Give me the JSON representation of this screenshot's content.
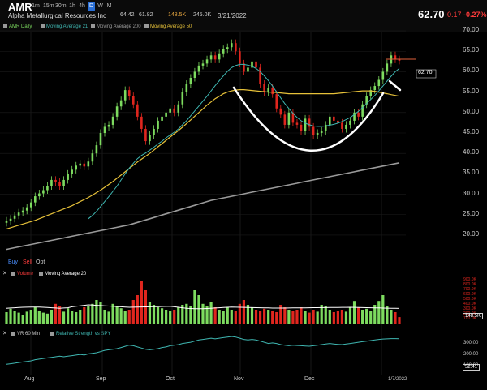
{
  "toolbar": {
    "symbol": "AMR",
    "intervals": [
      "1m",
      "15m",
      "30m",
      "1h",
      "4h",
      "D",
      "W",
      "M"
    ],
    "active_interval": "D",
    "date": "3/21/2022",
    "price": "62.70",
    "change": "-0.17",
    "change_pct": "-0.27%",
    "company": "Alpha Metallurgical Resources Inc",
    "high": "64.42",
    "low": "61.82",
    "volume": "148.5K",
    "avg_volume": "245.0K"
  },
  "legend": {
    "series": "AMR Daily",
    "ma21": "Moving Average 21",
    "ma200": "Moving Average 200",
    "ma50": "Moving Average 50"
  },
  "trade": {
    "buy": "Buy",
    "sell": "Sell",
    "opt": "Opt"
  },
  "volume_panel": {
    "label": "Volume",
    "ma": "Moving Average 20",
    "current": "148.5K"
  },
  "rs_panel": {
    "label": "VR 60 Min",
    "rs": "Relative Strength vs SPY",
    "current": "52.41"
  },
  "colors": {
    "up": "#7ddb5f",
    "down": "#e0261e",
    "ma21": "#3fb7b2",
    "ma50": "#e6c139",
    "ma200": "#9a9a9a",
    "accent": "#2a6fd6",
    "negative": "#ff3b3b",
    "bowl": "#ffffff"
  },
  "chart_data": {
    "type": "line",
    "title": "AMR Daily",
    "y_ticks": [
      "70.00",
      "65.00",
      "60.00",
      "55.00",
      "50.00",
      "45.00",
      "40.00",
      "35.00",
      "30.00",
      "25.00",
      "20.00"
    ],
    "x_ticks": [
      "Aug",
      "Sep",
      "Oct",
      "Nov",
      "Dec"
    ],
    "end_date_label": "1/7/2022",
    "vol_ticks": [
      "900.0K",
      "800.0K",
      "700.0K",
      "600.0K",
      "500.0K",
      "400.0K",
      "300.0K",
      "200.0K",
      "100.0K"
    ],
    "rs_ticks": [
      "300.00",
      "200.00",
      "100.00"
    ],
    "ylim": [
      18,
      72
    ],
    "close": [
      23.5,
      24.0,
      24.8,
      25.5,
      26.0,
      26.8,
      28.0,
      29.5,
      30.2,
      31.0,
      32.0,
      33.5,
      33.0,
      32.0,
      33.5,
      35.0,
      36.0,
      37.0,
      37.5,
      36.8,
      38.0,
      40.0,
      42.0,
      45.0,
      46.5,
      47.0,
      49.0,
      51.5,
      53.0,
      55.5,
      54.0,
      52.0,
      49.0,
      46.0,
      43.0,
      44.5,
      46.0,
      48.0,
      49.0,
      50.0,
      51.0,
      50.0,
      52.0,
      55.0,
      57.0,
      58.5,
      60.0,
      61.5,
      62.0,
      63.0,
      64.0,
      63.0,
      64.5,
      65.5,
      66.0,
      67.0,
      65.0,
      62.0,
      60.0,
      61.0,
      62.5,
      61.0,
      57.0,
      55.0,
      56.0,
      54.5,
      51.0,
      49.5,
      47.0,
      50.0,
      47.5,
      47.0,
      45.5,
      48.5,
      46.5,
      44.5,
      45.0,
      45.5,
      47.0,
      49.0,
      48.0,
      47.5,
      46.0,
      47.0,
      48.0,
      50.0,
      49.0,
      52.0,
      54.0,
      55.5,
      56.5,
      58.0,
      60.0,
      62.0,
      64.0,
      63.0,
      62.7
    ],
    "ma21": [
      null,
      null,
      null,
      null,
      null,
      null,
      null,
      null,
      null,
      null,
      null,
      null,
      null,
      null,
      null,
      null,
      null,
      null,
      null,
      null,
      24.0,
      24.8,
      25.8,
      27.0,
      28.2,
      29.4,
      30.7,
      32.0,
      33.5,
      35.0,
      36.4,
      37.6,
      38.7,
      39.5,
      40.1,
      40.8,
      41.5,
      42.3,
      43.0,
      43.8,
      44.5,
      45.2,
      46.0,
      47.0,
      48.0,
      49.2,
      50.4,
      51.6,
      52.8,
      54.0,
      55.3,
      56.6,
      57.8,
      59.0,
      60.1,
      61.0,
      61.5,
      61.8,
      61.8,
      61.6,
      61.3,
      60.8,
      60.0,
      59.0,
      57.8,
      56.5,
      55.0,
      53.6,
      52.2,
      51.0,
      49.8,
      48.8,
      48.0,
      47.4,
      47.0,
      46.7,
      46.6,
      46.6,
      46.7,
      46.9,
      47.1,
      47.4,
      47.8,
      48.3,
      48.8,
      49.5,
      50.3,
      51.2,
      52.2,
      53.2,
      54.2,
      55.3,
      56.5,
      57.7,
      58.9,
      60.0,
      60.8
    ],
    "ma50": [
      21.5,
      21.8,
      22.1,
      22.4,
      22.7,
      23.0,
      23.3,
      23.6,
      24.0,
      24.4,
      24.8,
      25.2,
      25.6,
      26.0,
      26.4,
      26.8,
      27.2,
      27.7,
      28.2,
      28.7,
      29.2,
      29.8,
      30.4,
      31.0,
      31.7,
      32.4,
      33.1,
      33.9,
      34.7,
      35.5,
      36.3,
      37.1,
      37.9,
      38.6,
      39.3,
      40.0,
      40.8,
      41.6,
      42.4,
      43.2,
      44.0,
      44.8,
      45.6,
      46.4,
      47.3,
      48.2,
      49.1,
      50.0,
      50.9,
      51.8,
      52.6,
      53.4,
      54.0,
      54.6,
      55.0,
      55.3,
      55.5,
      55.6,
      55.6,
      55.5,
      55.4,
      55.3,
      55.2,
      55.1,
      55.0,
      55.0,
      54.9,
      54.8,
      54.7,
      54.6,
      54.6,
      54.6,
      54.6,
      54.6,
      54.6,
      54.6,
      54.6,
      54.6,
      54.6,
      54.6,
      54.6,
      54.7,
      54.8,
      54.9,
      55.0,
      55.1,
      55.2,
      55.3,
      55.3,
      55.3,
      55.2,
      55.0,
      54.8,
      54.6,
      54.4,
      54.2,
      54.0
    ],
    "ma200": [
      16.5,
      16.7,
      16.9,
      17.1,
      17.3,
      17.5,
      17.7,
      17.9,
      18.1,
      18.3,
      18.5,
      18.7,
      18.9,
      19.1,
      19.3,
      19.5,
      19.7,
      19.9,
      20.1,
      20.3,
      20.5,
      20.7,
      20.9,
      21.1,
      21.3,
      21.5,
      21.7,
      21.9,
      22.1,
      22.3,
      22.5,
      22.8,
      23.1,
      23.4,
      23.7,
      24.0,
      24.3,
      24.6,
      24.9,
      25.2,
      25.5,
      25.8,
      26.1,
      26.4,
      26.7,
      27.0,
      27.3,
      27.6,
      27.9,
      28.2,
      28.5,
      28.7,
      28.9,
      29.1,
      29.3,
      29.5,
      29.7,
      29.9,
      30.1,
      30.3,
      30.5,
      30.7,
      30.9,
      31.1,
      31.3,
      31.5,
      31.7,
      31.9,
      32.1,
      32.3,
      32.5,
      32.7,
      32.9,
      33.1,
      33.3,
      33.5,
      33.7,
      33.9,
      34.1,
      34.3,
      34.5,
      34.7,
      34.9,
      35.1,
      35.3,
      35.5,
      35.7,
      35.9,
      36.1,
      36.3,
      36.5,
      36.7,
      36.9,
      37.1,
      37.3,
      37.5,
      37.7
    ],
    "volume": [
      250,
      320,
      280,
      240,
      200,
      260,
      300,
      350,
      280,
      240,
      220,
      300,
      420,
      380,
      260,
      330,
      280,
      250,
      300,
      350,
      380,
      420,
      500,
      450,
      300,
      260,
      420,
      380,
      330,
      280,
      300,
      500,
      600,
      900,
      700,
      450,
      400,
      350,
      330,
      300,
      280,
      300,
      350,
      400,
      420,
      380,
      700,
      600,
      420,
      380,
      450,
      350,
      300,
      280,
      350,
      300,
      280,
      420,
      500,
      400,
      350,
      300,
      280,
      320,
      300,
      280,
      250,
      400,
      350,
      300,
      280,
      300,
      350,
      280,
      240,
      300,
      260,
      400,
      380,
      300,
      250,
      280,
      300,
      260,
      350,
      480,
      350,
      300,
      320,
      280,
      400,
      480,
      600,
      380,
      300,
      250,
      148.5
    ],
    "vol_ma": [
      330,
      335,
      340,
      345,
      350,
      352,
      354,
      355,
      355,
      350,
      345,
      340,
      335,
      330,
      335,
      340,
      360,
      370,
      380,
      390,
      400,
      395,
      390,
      385,
      380,
      375,
      370,
      365,
      360,
      355,
      350,
      352,
      354,
      356,
      358,
      360,
      362,
      364,
      366,
      368,
      370,
      360,
      350,
      340,
      330,
      325,
      320,
      320,
      322,
      325,
      330,
      335,
      340,
      345,
      350,
      355,
      352,
      350,
      348,
      346,
      344,
      342,
      340,
      338,
      336,
      334,
      333,
      333,
      334,
      335,
      336,
      337,
      338,
      339,
      340,
      341,
      342,
      343,
      344,
      345,
      346,
      347,
      348,
      349,
      350,
      348,
      346,
      344,
      342,
      340,
      338,
      336,
      334,
      332,
      330,
      328,
      326
    ],
    "rs": [
      120,
      125,
      130,
      135,
      140,
      145,
      150,
      160,
      165,
      170,
      175,
      180,
      185,
      190,
      185,
      190,
      195,
      200,
      205,
      200,
      210,
      215,
      220,
      230,
      240,
      245,
      250,
      255,
      265,
      275,
      285,
      280,
      270,
      260,
      250,
      245,
      250,
      255,
      265,
      270,
      280,
      285,
      290,
      300,
      305,
      310,
      320,
      330,
      335,
      340,
      345,
      340,
      345,
      350,
      355,
      360,
      355,
      345,
      335,
      330,
      335,
      330,
      320,
      310,
      300,
      305,
      300,
      290,
      285,
      280,
      285,
      282,
      280,
      278,
      276,
      280,
      285,
      290,
      295,
      300,
      295,
      292,
      290,
      295,
      300,
      305,
      310,
      315,
      320,
      325,
      330,
      335,
      338,
      340,
      342,
      342,
      341
    ]
  }
}
